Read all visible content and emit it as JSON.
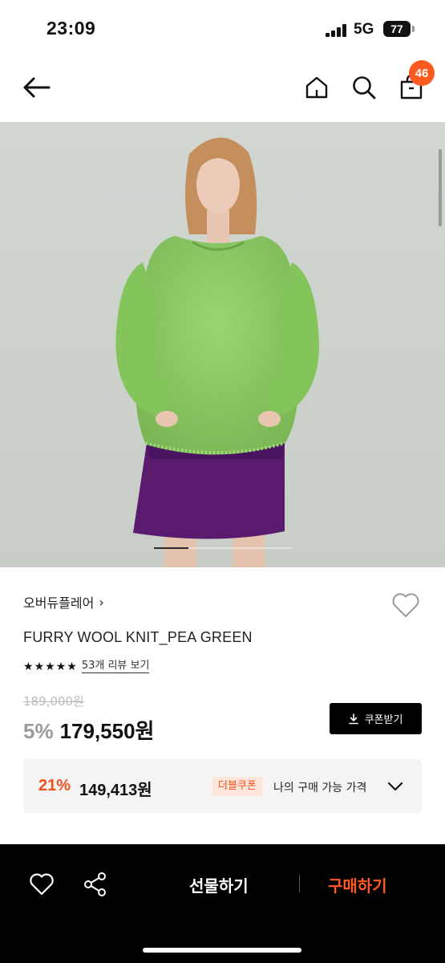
{
  "status_bar": {
    "time": "23:09",
    "network": "5G",
    "battery": "77"
  },
  "header": {
    "back_icon": "arrow-left-icon",
    "home_icon": "home-icon",
    "search_icon": "search-icon",
    "bag_icon": "shopping-bag-icon",
    "cart_count": "46"
  },
  "gallery": {
    "current_slide_fraction": 0.25
  },
  "product": {
    "brand": "오버듀플레어",
    "brand_arrow": "›",
    "name": "FURRY WOOL KNIT_PEA GREEN",
    "rating_stars": 5,
    "review_link": "53개 리뷰 보기",
    "original_price": "189,000원",
    "discount_rate": "5%",
    "sale_price": "179,550원",
    "coupon_button": "쿠폰받기"
  },
  "benefit": {
    "rate": "21%",
    "price": "149,413원",
    "badge": "더블쿠폰",
    "label": "나의 구매 가능 가격"
  },
  "bottom_bar": {
    "gift_label": "선물하기",
    "buy_label": "구매하기"
  },
  "colors": {
    "accent": "#ff5a1f",
    "benefit_red": "#f2511b",
    "sweater_green": "#8bc963",
    "skirt_purple": "#5a1a6e"
  }
}
